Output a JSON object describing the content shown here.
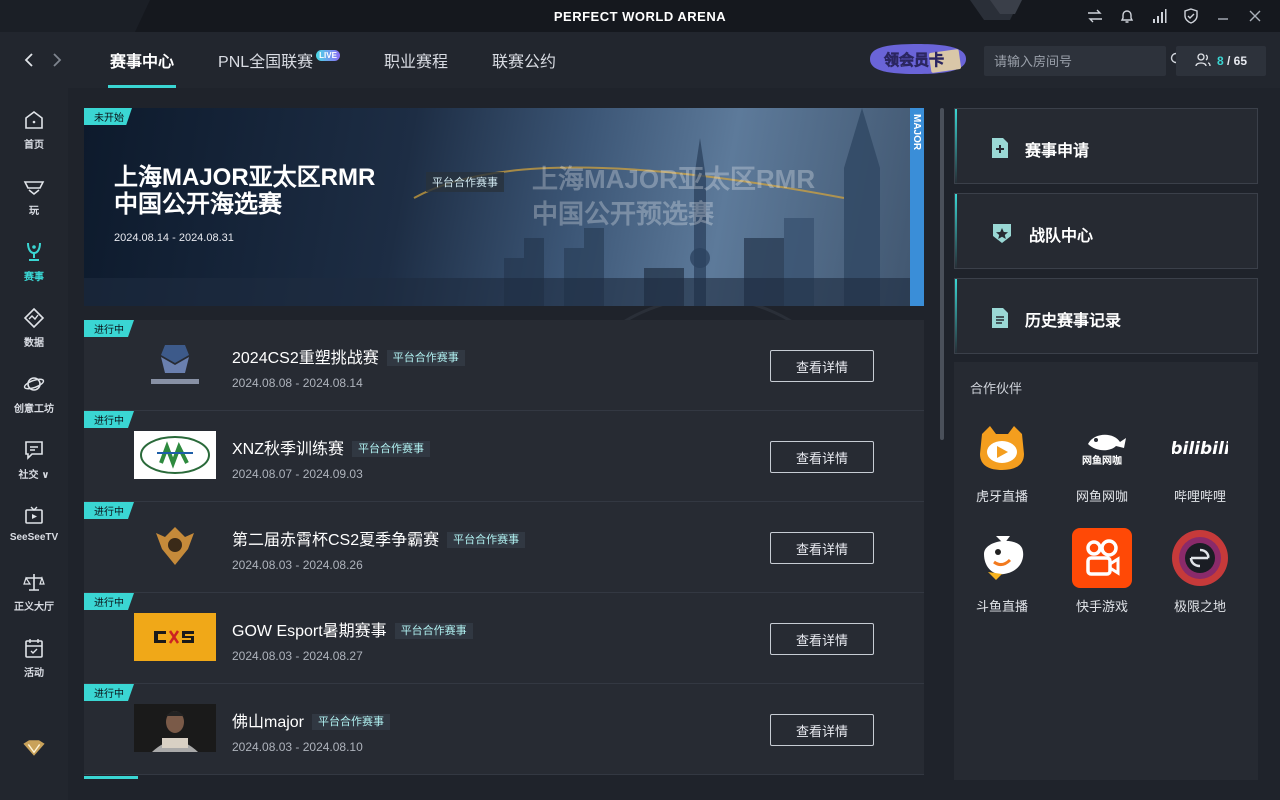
{
  "window": {
    "title": "PERFECT WORLD ARENA"
  },
  "nav": {
    "tabs": [
      {
        "label": "赛事中心",
        "active": true
      },
      {
        "label": "PNL全国联赛",
        "badge": "LIVE"
      },
      {
        "label": "职业赛程"
      },
      {
        "label": "联赛公约"
      }
    ],
    "vip_label": "领会员卡",
    "search_placeholder": "请输入房间号",
    "friends_online": "8",
    "friends_total": "/ 65"
  },
  "sidebar": {
    "items": [
      {
        "label": "首页",
        "icon": "home-icon"
      },
      {
        "label": "玩",
        "icon": "controller-icon"
      },
      {
        "label": "赛事",
        "icon": "trophy-icon",
        "active": true
      },
      {
        "label": "数据",
        "icon": "data-icon"
      },
      {
        "label": "创意工坊",
        "icon": "planet-icon"
      },
      {
        "label": "社交 ∨",
        "icon": "chat-icon"
      },
      {
        "label": "SeeSeeTV",
        "icon": "tv-icon"
      },
      {
        "label": "正义大厅",
        "icon": "scales-icon"
      },
      {
        "label": "活动",
        "icon": "calendar-icon"
      }
    ]
  },
  "banner": {
    "status": "未开始",
    "title_line1": "上海MAJOR亚太区RMR",
    "title_line2": "中国公开海选赛",
    "tag": "平台合作赛事",
    "date": "2024.08.14 - 2024.08.31",
    "art_line1": "上海MAJOR亚太区RMR",
    "art_line2": "中国公开预选赛",
    "side_text": "MAJOR"
  },
  "tournaments": [
    {
      "status": "进行中",
      "name": "2024CS2重塑挑战赛",
      "tag": "平台合作赛事",
      "date": "2024.08.08 - 2024.08.14",
      "button": "查看详情"
    },
    {
      "status": "进行中",
      "name": "XNZ秋季训练赛",
      "tag": "平台合作赛事",
      "date": "2024.08.07 - 2024.09.03",
      "button": "查看详情"
    },
    {
      "status": "进行中",
      "name": "第二届赤霄杯CS2夏季争霸赛",
      "tag": "平台合作赛事",
      "date": "2024.08.03 - 2024.08.26",
      "button": "查看详情"
    },
    {
      "status": "进行中",
      "name": "GOW Esport暑期赛事",
      "tag": "平台合作赛事",
      "date": "2024.08.03 - 2024.08.27",
      "button": "查看详情"
    },
    {
      "status": "进行中",
      "name": "佛山major",
      "tag": "平台合作赛事",
      "date": "2024.08.03 - 2024.08.10",
      "button": "查看详情"
    }
  ],
  "actions": [
    {
      "label": "赛事申请",
      "icon": "plus-doc-icon"
    },
    {
      "label": "战队中心",
      "icon": "star-shield-icon"
    },
    {
      "label": "历史赛事记录",
      "icon": "document-icon"
    }
  ],
  "partners": {
    "title": "合作伙伴",
    "items": [
      {
        "name": "虎牙直播",
        "icon": "huya-logo"
      },
      {
        "name": "网鱼网咖",
        "icon": "wangyu-logo"
      },
      {
        "name": "哔哩哔哩",
        "icon": "bilibili-logo"
      },
      {
        "name": "斗鱼直播",
        "icon": "douyu-logo"
      },
      {
        "name": "快手游戏",
        "icon": "kuaishou-logo"
      },
      {
        "name": "极限之地",
        "icon": "jixian-logo"
      }
    ]
  },
  "colors": {
    "accent": "#3ad6d3",
    "background": "#1f232b",
    "panel": "#262a32"
  }
}
